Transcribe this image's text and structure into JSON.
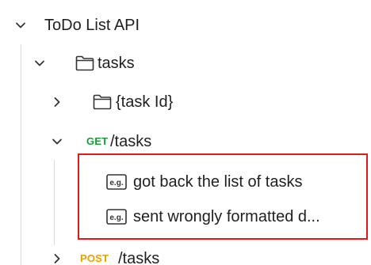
{
  "tree": {
    "collection": {
      "label": "ToDo List API",
      "icon": "chevron-down-icon"
    },
    "folder_tasks": {
      "label": "tasks",
      "icon": "folder-icon",
      "chevron": "chevron-down-icon"
    },
    "folder_task_id": {
      "label": "{task Id}",
      "icon": "folder-icon",
      "chevron": "chevron-right-icon"
    },
    "request_get": {
      "method": "GET",
      "path": "/tasks",
      "chevron": "chevron-down-icon",
      "method_color": "#1d9a3c"
    },
    "examples": [
      {
        "label": "got back the list of tasks",
        "icon": "example-icon"
      },
      {
        "label": "sent wrongly formatted d...",
        "icon": "example-icon"
      }
    ],
    "request_post": {
      "method": "POST",
      "path": "/tasks",
      "chevron": "chevron-right-icon",
      "method_color": "#e8a200"
    }
  },
  "highlight_color": "#e01a1a"
}
